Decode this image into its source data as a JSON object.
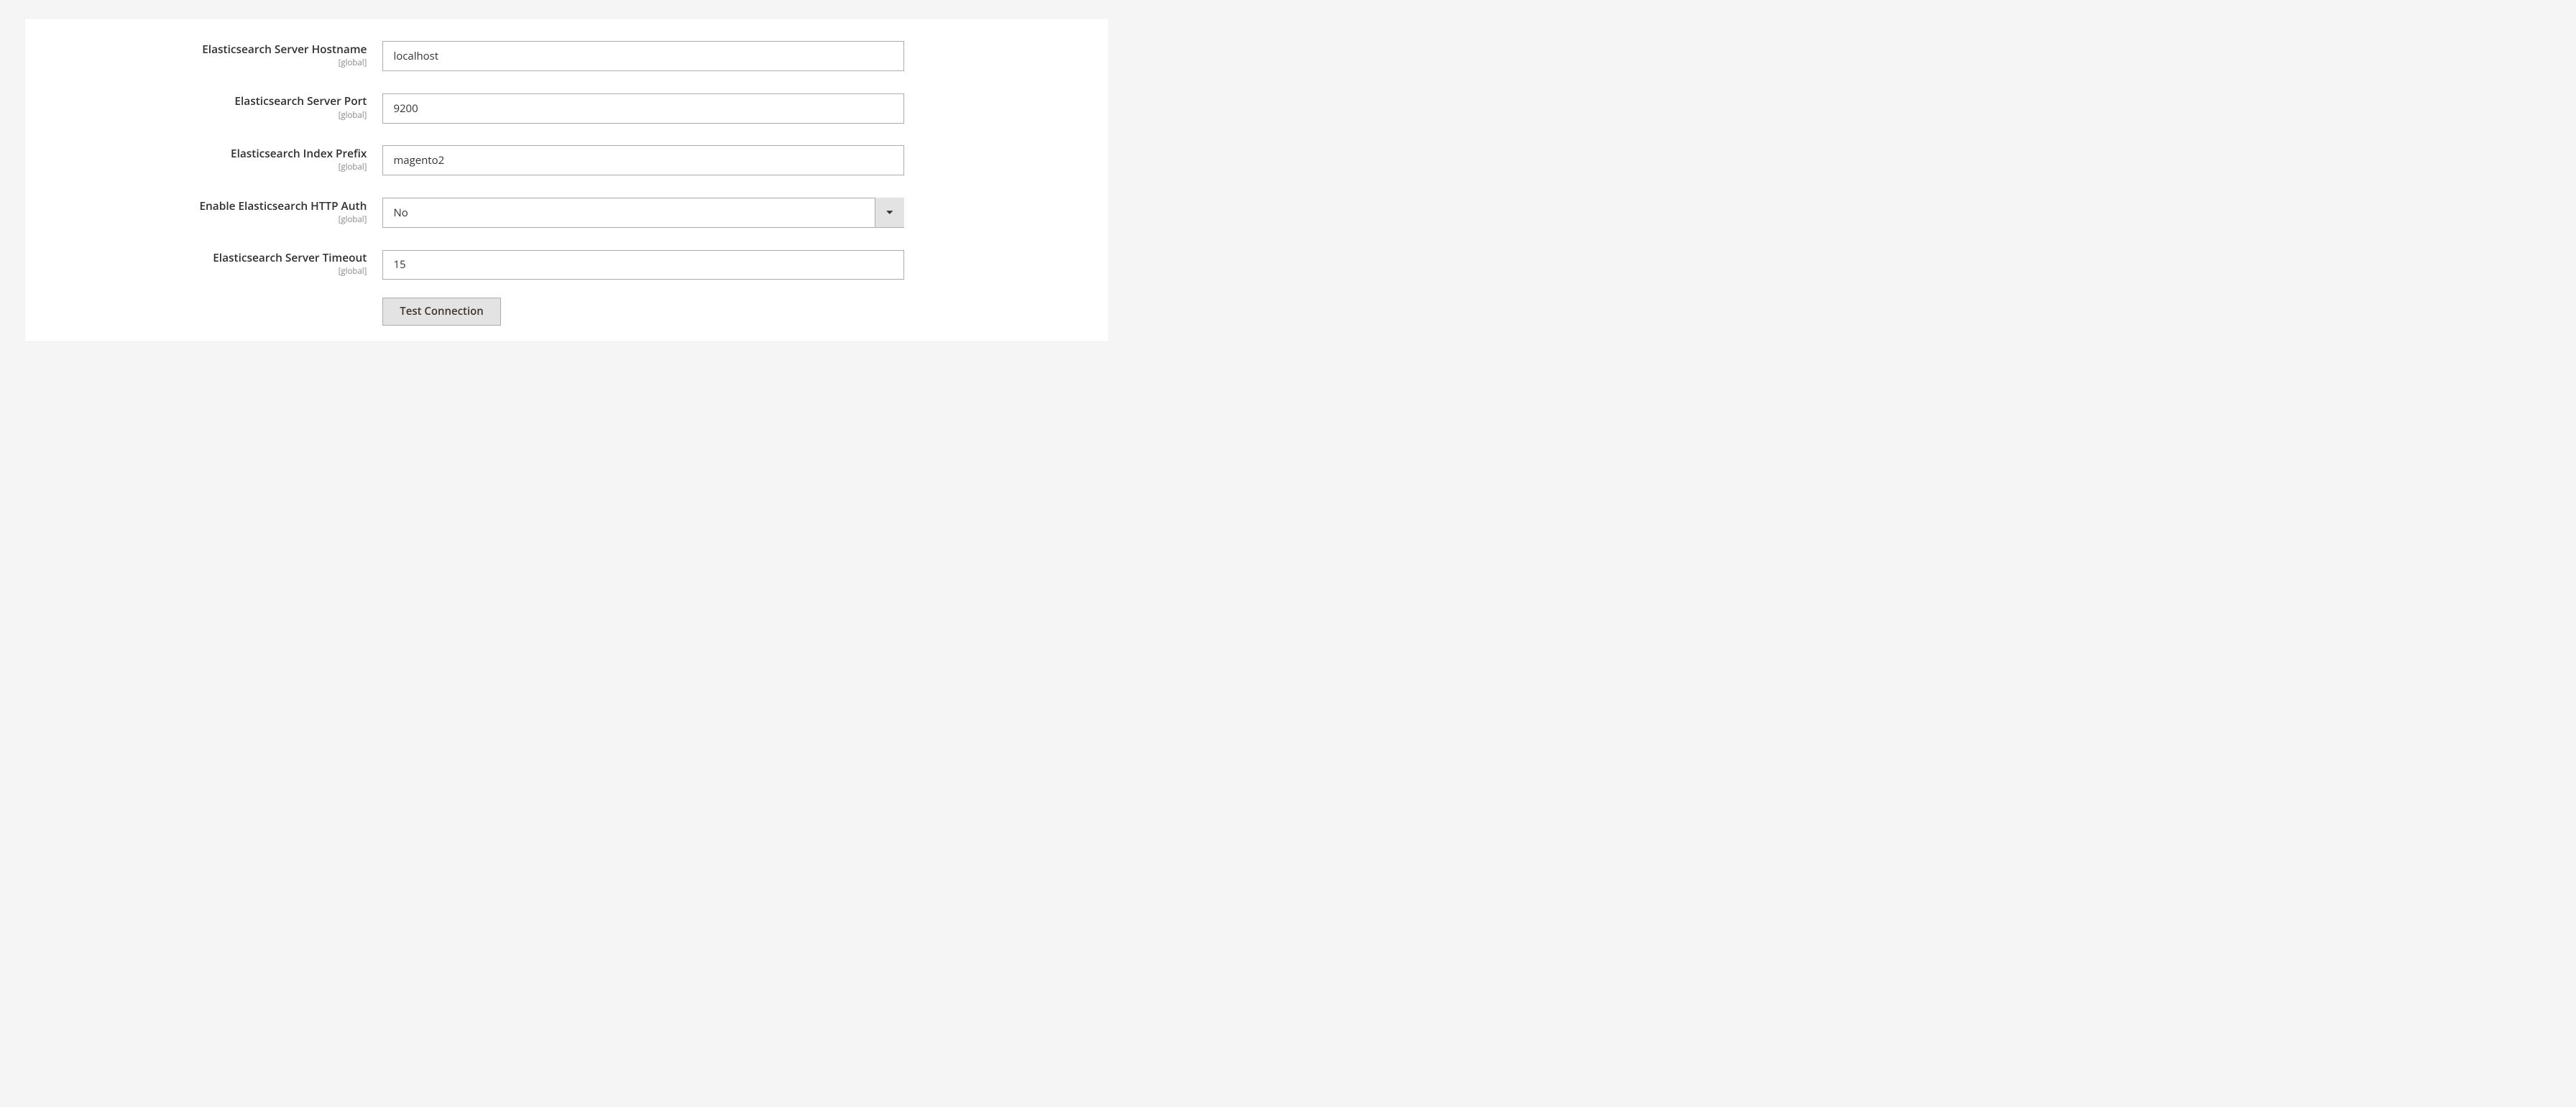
{
  "form": {
    "fields": {
      "hostname": {
        "label": "Elasticsearch Server Hostname",
        "scope": "[global]",
        "value": "localhost"
      },
      "port": {
        "label": "Elasticsearch Server Port",
        "scope": "[global]",
        "value": "9200"
      },
      "prefix": {
        "label": "Elasticsearch Index Prefix",
        "scope": "[global]",
        "value": "magento2"
      },
      "httpauth": {
        "label": "Enable Elasticsearch HTTP Auth",
        "scope": "[global]",
        "value": "No"
      },
      "timeout": {
        "label": "Elasticsearch Server Timeout",
        "scope": "[global]",
        "value": "15"
      }
    },
    "actions": {
      "test_connection": "Test Connection"
    }
  }
}
